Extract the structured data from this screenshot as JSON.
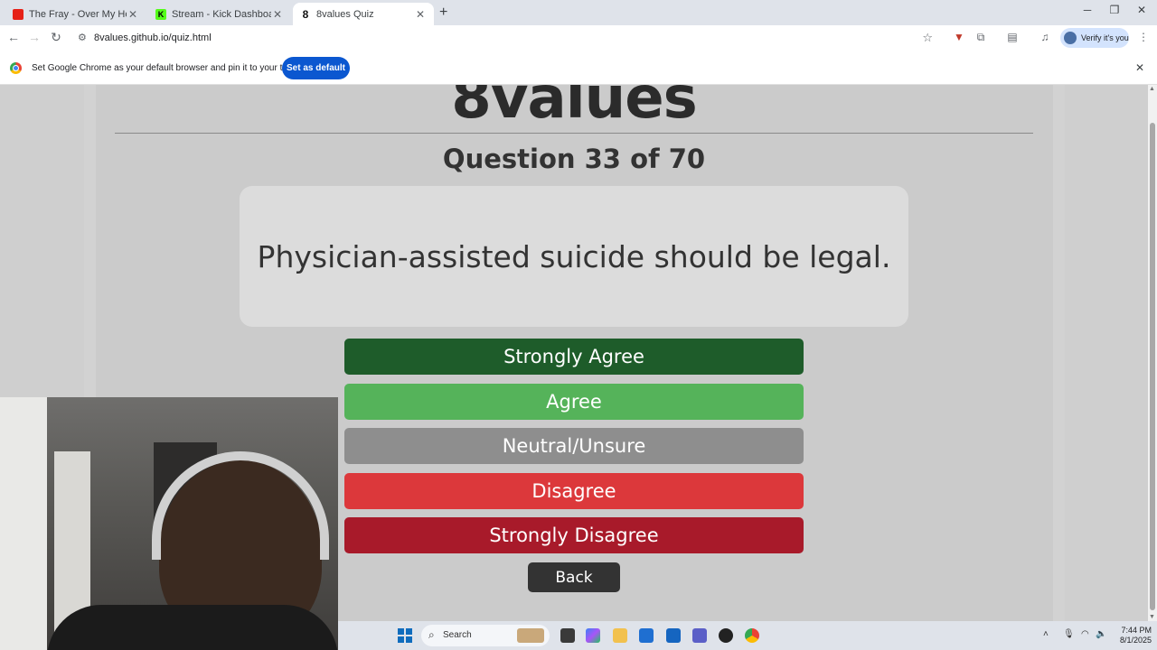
{
  "browser": {
    "tabs": [
      {
        "title": "The Fray - Over My Head (Cable",
        "favicon": "youtube-icon"
      },
      {
        "title": "Stream - Kick Dashboard",
        "favicon": "kick-icon"
      },
      {
        "title": "8values Quiz",
        "favicon": "8values-icon",
        "favicon_text": "8"
      }
    ],
    "url": "8values.github.io/quiz.html",
    "profile_label": "Verify it's you",
    "infobar_message": "Set Google Chrome as your default browser and pin it to your taskbar",
    "infobar_button": "Set as default"
  },
  "quiz": {
    "logo": "8values",
    "question_counter": "Question 33 of 70",
    "question_text": "Physician-assisted suicide should be legal.",
    "answers": [
      {
        "label": "Strongly Agree",
        "color": "#1e5c2a"
      },
      {
        "label": "Agree",
        "color": "#55b35a"
      },
      {
        "label": "Neutral/Unsure",
        "color": "#8e8e8e"
      },
      {
        "label": "Disagree",
        "color": "#dc383b"
      },
      {
        "label": "Strongly Disagree",
        "color": "#a81a2a"
      }
    ],
    "back_label": "Back"
  },
  "taskbar": {
    "search_placeholder": "Search",
    "time": "7:44 PM",
    "date": "8/1/2025"
  }
}
